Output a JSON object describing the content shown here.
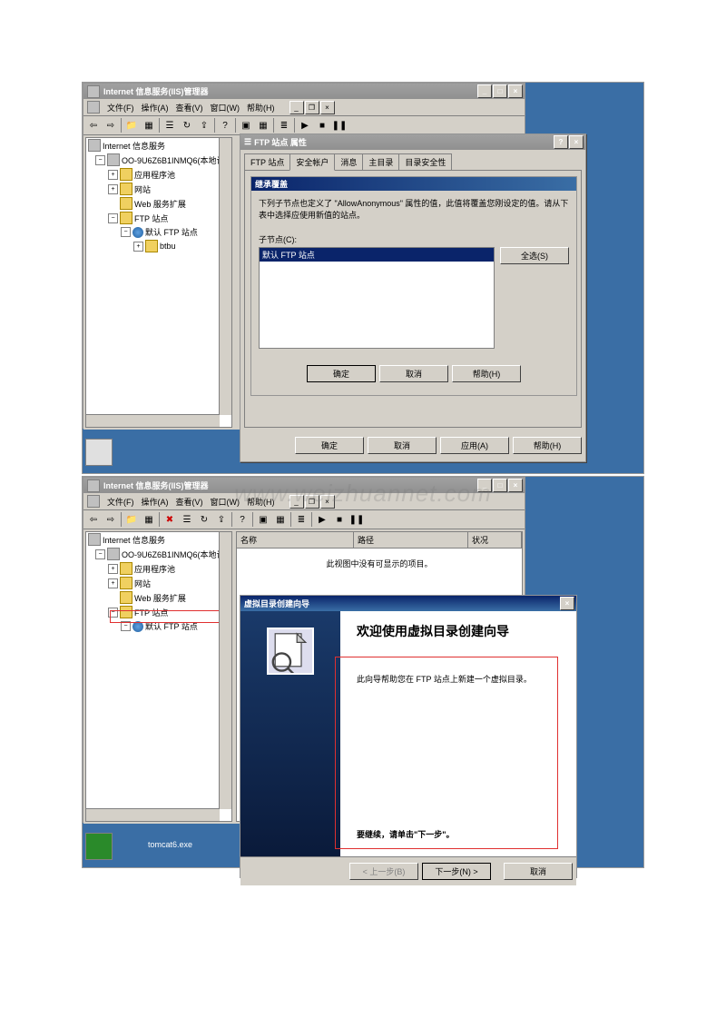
{
  "watermark": "www.weizhuannet.com",
  "sc1": {
    "win_title": "Internet 信息服务(IIS)管理器",
    "menu": {
      "file": "文件(F)",
      "action": "操作(A)",
      "view": "查看(V)",
      "window": "窗口(W)",
      "help": "帮助(H)"
    },
    "tree": {
      "root": "Internet 信息服务",
      "host": "OO-9U6Z6B1INMQ6(本地计",
      "apppools": "应用程序池",
      "sites": "网站",
      "webext": "Web 服务扩展",
      "ftpsites": "FTP 站点",
      "defftp": "默认 FTP 站点",
      "btbu": "btbu"
    },
    "prop": {
      "title": "FTP 站点 属性",
      "tabs": {
        "site": "FTP 站点",
        "acct": "安全帐户",
        "msg": "消息",
        "home": "主目录",
        "dirsec": "目录安全性"
      },
      "inner_title": "继承覆盖",
      "inner_text1": "下列子节点也定义了 \"AllowAnonymous\" 属性的值，此值将覆盖您刚设定的值。请从下表中选择应使用新值的站点。",
      "child_label": "子节点(C):",
      "child_item": "默认 FTP 站点",
      "select_all": "全选(S)",
      "ok": "确定",
      "cancel": "取消",
      "help": "帮助(H)",
      "apply": "应用(A)"
    }
  },
  "sc2": {
    "win_title": "Internet 信息服务(IIS)管理器",
    "menu": {
      "file": "文件(F)",
      "action": "操作(A)",
      "view": "查看(V)",
      "window": "窗口(W)",
      "help": "帮助(H)"
    },
    "tree": {
      "root": "Internet 信息服务",
      "host": "OO-9U6Z6B1INMQ6(本地计",
      "apppools": "应用程序池",
      "sites": "网站",
      "webext": "Web 服务扩展",
      "ftpsites": "FTP 站点",
      "defftp": "默认 FTP 站点"
    },
    "cols": {
      "name": "名称",
      "path": "路径",
      "status": "状况"
    },
    "empty": "此视图中没有可显示的项目。",
    "wizard": {
      "title": "虚拟目录创建向导",
      "heading": "欢迎使用虚拟目录创建向导",
      "text1": "此向导帮助您在 FTP 站点上新建一个虚拟目录。",
      "text2": "要继续，请单击\"下一步\"。",
      "back": "< 上一步(B)",
      "next": "下一步(N) >",
      "cancel": "取消"
    },
    "desktop_label": "tomcat6.exe"
  }
}
